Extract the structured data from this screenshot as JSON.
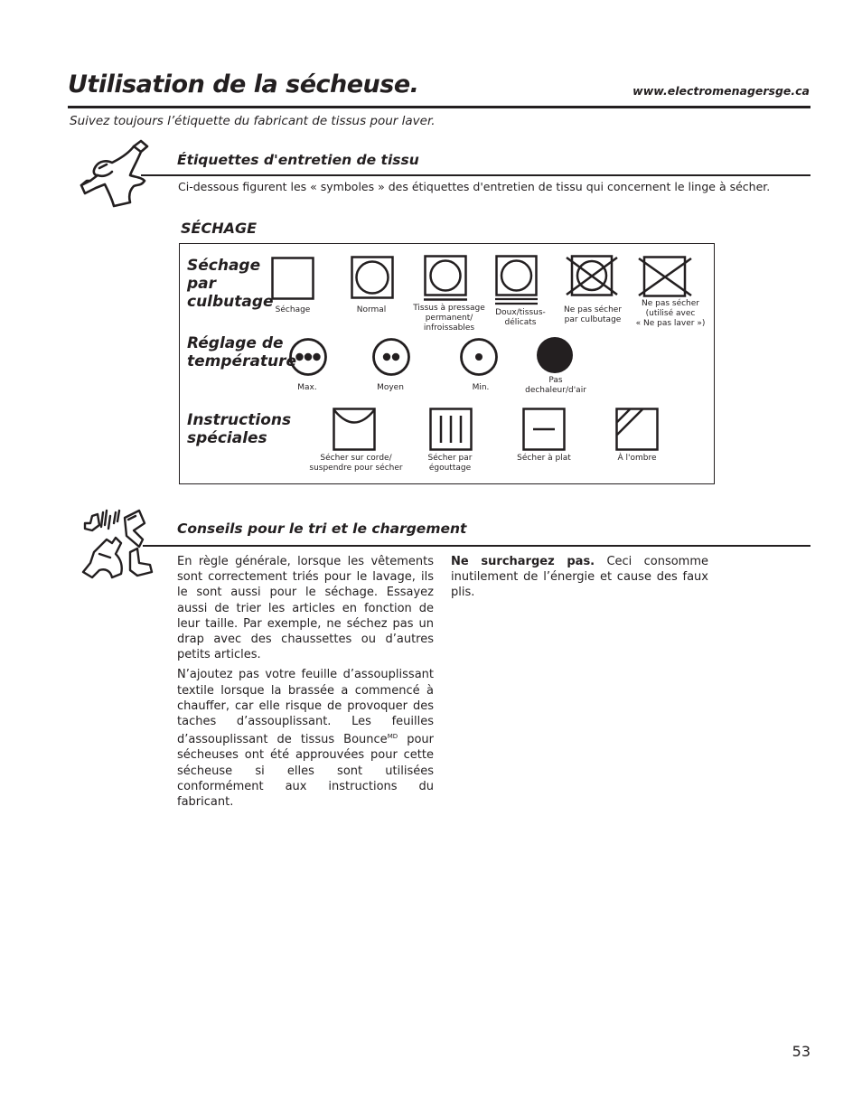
{
  "header": {
    "title": "Utilisation de la sécheuse.",
    "url": "www.electromenagersge.ca",
    "subtitle": "Suivez toujours l’étiquette du fabricant de tissus pour laver."
  },
  "care_labels_section": {
    "icon": "tumbling-shirt-icon",
    "heading": "Étiquettes d'entretien de tissu",
    "intro": "Ci-dessous figurent les « symboles » des étiquettes d'entretien de tissu qui concernent le linge à sécher."
  },
  "drying_table": {
    "title": "SÉCHAGE",
    "rows": [
      {
        "label_lines": [
          "Séchage",
          "par",
          "culbutage"
        ],
        "symbols": [
          {
            "icon": "square-icon",
            "label_lines": [
              "Séchage"
            ]
          },
          {
            "icon": "square-circle-icon",
            "label_lines": [
              "Normal"
            ]
          },
          {
            "icon": "square-circle-one-bar-icon",
            "label_lines": [
              "Tissus à pressage",
              "permanent/",
              "infroissables"
            ]
          },
          {
            "icon": "square-circle-two-bars-icon",
            "label_lines": [
              "Doux/tissus-",
              "délicats"
            ]
          },
          {
            "icon": "square-circle-crossed-icon",
            "label_lines": [
              "Ne pas sécher",
              "par culbutage"
            ]
          },
          {
            "icon": "square-crossed-icon",
            "label_lines": [
              "Ne pas sécher",
              "(utilisé avec",
              "« Ne pas laver »)"
            ]
          }
        ]
      },
      {
        "label_lines": [
          "Réglage de",
          "température"
        ],
        "symbols": [
          {
            "icon": "circle-three-dots-icon",
            "label_lines": [
              "Max."
            ]
          },
          {
            "icon": "circle-two-dots-icon",
            "label_lines": [
              "Moyen"
            ]
          },
          {
            "icon": "circle-one-dot-icon",
            "label_lines": [
              "Min."
            ]
          },
          {
            "icon": "filled-circle-icon",
            "label_lines": [
              "Pas",
              "dechaleur/d'air"
            ]
          }
        ]
      },
      {
        "label_lines": [
          "Instructions",
          "spéciales"
        ],
        "symbols": [
          {
            "icon": "square-line-dry-icon",
            "label_lines": [
              "Sécher sur corde/",
              "suspendre pour sécher"
            ]
          },
          {
            "icon": "square-drip-dry-icon",
            "label_lines": [
              "Sécher par",
              "égouttage"
            ]
          },
          {
            "icon": "square-dry-flat-icon",
            "label_lines": [
              "Sécher à plat"
            ]
          },
          {
            "icon": "square-shade-icon",
            "label_lines": [
              "À l'ombre"
            ]
          }
        ]
      }
    ]
  },
  "sorting_section": {
    "icon": "tumbling-clothes-icon",
    "heading": "Conseils pour le tri et le chargement",
    "left_paragraphs": [
      "En règle générale, lorsque les vêtements sont correctement triés pour le lavage, ils le sont aussi pour le séchage. Essayez aussi de trier les articles en fonction de leur taille. Par exemple, ne séchez pas un drap avec des chaussettes ou d’autres petits articles.",
      {
        "before": "N’ajoutez pas votre feuille d’assouplissant textile lorsque la brassée a commencé à chauffer, car elle risque de provoquer des taches d’assouplissant. Les feuilles d’assouplissant de tissus Bounce",
        "sup": "MD",
        "after": " pour sécheuses ont été approuvées pour cette sécheuse si elles sont utilisées conformément aux instructions du fabricant."
      }
    ],
    "right_paragraph": {
      "bold": "Ne surchargez pas.",
      "text": " Ceci consomme inutilement de l’énergie et cause des faux plis."
    }
  },
  "footer": {
    "page_number": "53"
  }
}
